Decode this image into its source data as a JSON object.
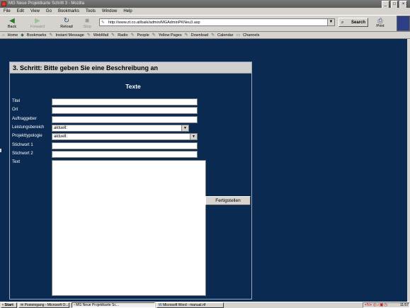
{
  "window": {
    "title": "MG Neue Projektkarte Schritt 3 - Mozilla",
    "controls": [
      "_",
      "□",
      "×"
    ]
  },
  "menu": [
    "File",
    "Edit",
    "View",
    "Go",
    "Bookmarks",
    "Tools",
    "Window",
    "Help"
  ],
  "nav": {
    "back": "Back",
    "forward": "Forward",
    "reload": "Reload",
    "stop": "Stop",
    "url": "http://www.zt.co.at/baik/admin/MGAdminPKNeu3.asp",
    "search": "Search",
    "print": "Print"
  },
  "bookmarks": [
    "Home",
    "Bookmarks",
    "Instant Message",
    "WebMail",
    "Radio",
    "People",
    "Yellow Pages",
    "Download",
    "Calendar",
    "Channels"
  ],
  "form": {
    "step_title": "3. Schritt: Bitte geben Sie eine Beschreibung an",
    "section_title": "Texte",
    "labels": {
      "titel": "Titel",
      "ort": "Ort",
      "auftraggeber": "Auftraggeber",
      "leistungsbereich": "Leistungsbereich",
      "projekttypologie": "Projekttypologie",
      "stichwort1": "Stichwort 1",
      "stichwort2": "Stichwort 2",
      "text": "Text"
    },
    "values": {
      "titel": "",
      "ort": "",
      "auftraggeber": "",
      "stichwort1": "",
      "stichwort2": "",
      "text": ""
    },
    "leistungsbereich_selected": "aktuell:",
    "projekttypologie_selected": "aktuell:",
    "submit": "Fertigstellen"
  },
  "taskbar": {
    "start": "Start",
    "tasks": [
      "Posteingang - Microsoft O...",
      "MG Neue Projektkarte Sc...",
      "Microsoft Word - manual.rtf"
    ],
    "clock": "11:57"
  }
}
